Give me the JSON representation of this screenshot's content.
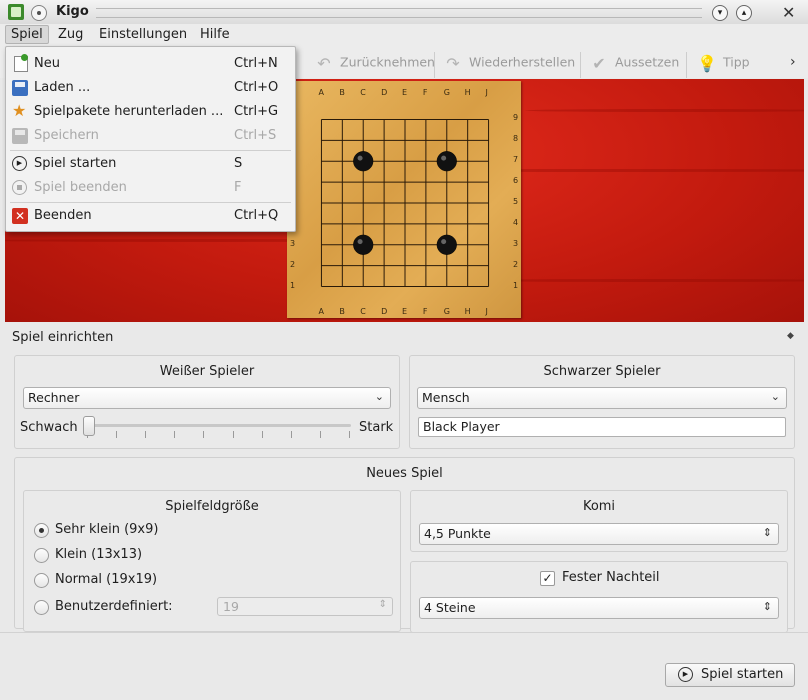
{
  "window": {
    "title": "Kigo"
  },
  "menubar": {
    "items": [
      "Spiel",
      "Zug",
      "Einstellungen",
      "Hilfe"
    ]
  },
  "toolbar": {
    "undo": "Zurücknehmen",
    "redo": "Wiederherstellen",
    "pass": "Aussetzen",
    "hint": "Tipp",
    "overflow": "›"
  },
  "menu": {
    "items": [
      {
        "label": "Neu",
        "shortcut": "Ctrl+N",
        "icon": "new-document-icon",
        "enabled": true
      },
      {
        "label": "Laden ...",
        "shortcut": "Ctrl+O",
        "icon": "open-file-icon",
        "enabled": true
      },
      {
        "label": "Spielpakete herunterladen ...",
        "shortcut": "Ctrl+G",
        "icon": "star-icon",
        "enabled": true
      },
      {
        "label": "Speichern",
        "shortcut": "Ctrl+S",
        "icon": "save-icon",
        "enabled": false
      },
      {
        "label": "Spiel starten",
        "shortcut": "S",
        "icon": "play-icon",
        "enabled": true
      },
      {
        "label": "Spiel beenden",
        "shortcut": "F",
        "icon": "stop-icon",
        "enabled": false
      },
      {
        "label": "Beenden",
        "shortcut": "Ctrl+Q",
        "icon": "quit-icon",
        "enabled": true
      }
    ]
  },
  "board": {
    "size": 9,
    "col_labels": [
      "A",
      "B",
      "C",
      "D",
      "E",
      "F",
      "G",
      "H",
      "J"
    ],
    "row_labels_left": [
      "3",
      "2",
      "1"
    ],
    "row_labels_right": [
      "9",
      "8",
      "7",
      "6",
      "5",
      "4",
      "3",
      "2",
      "1"
    ],
    "stones": [
      {
        "color": "black",
        "col": "C",
        "row": 7
      },
      {
        "color": "black",
        "col": "G",
        "row": 7
      },
      {
        "color": "black",
        "col": "C",
        "row": 3
      },
      {
        "color": "black",
        "col": "G",
        "row": 3
      }
    ]
  },
  "setup": {
    "title": "Spiel einrichten",
    "white": {
      "title": "Weißer Spieler",
      "type": "Rechner",
      "weak": "Schwach",
      "strong": "Stark",
      "strength": 0.0
    },
    "black": {
      "title": "Schwarzer Spieler",
      "type": "Mensch",
      "name": "Black Player"
    },
    "new_game": {
      "title": "Neues Spiel",
      "board_size": {
        "title": "Spielfeldgröße",
        "options": [
          "Sehr klein (9x9)",
          "Klein (13x13)",
          "Normal (19x19)",
          "Benutzerdefiniert:"
        ],
        "selected": 0,
        "custom_value": "19"
      },
      "komi": {
        "title": "Komi",
        "value": "4,5 Punkte"
      },
      "handicap": {
        "label": "Fester Nachteil",
        "checked": true,
        "value": "4 Steine"
      }
    },
    "start_button": "Spiel starten"
  },
  "colors": {
    "board_bg": "#c21a0e",
    "wood": "#e0a850"
  }
}
